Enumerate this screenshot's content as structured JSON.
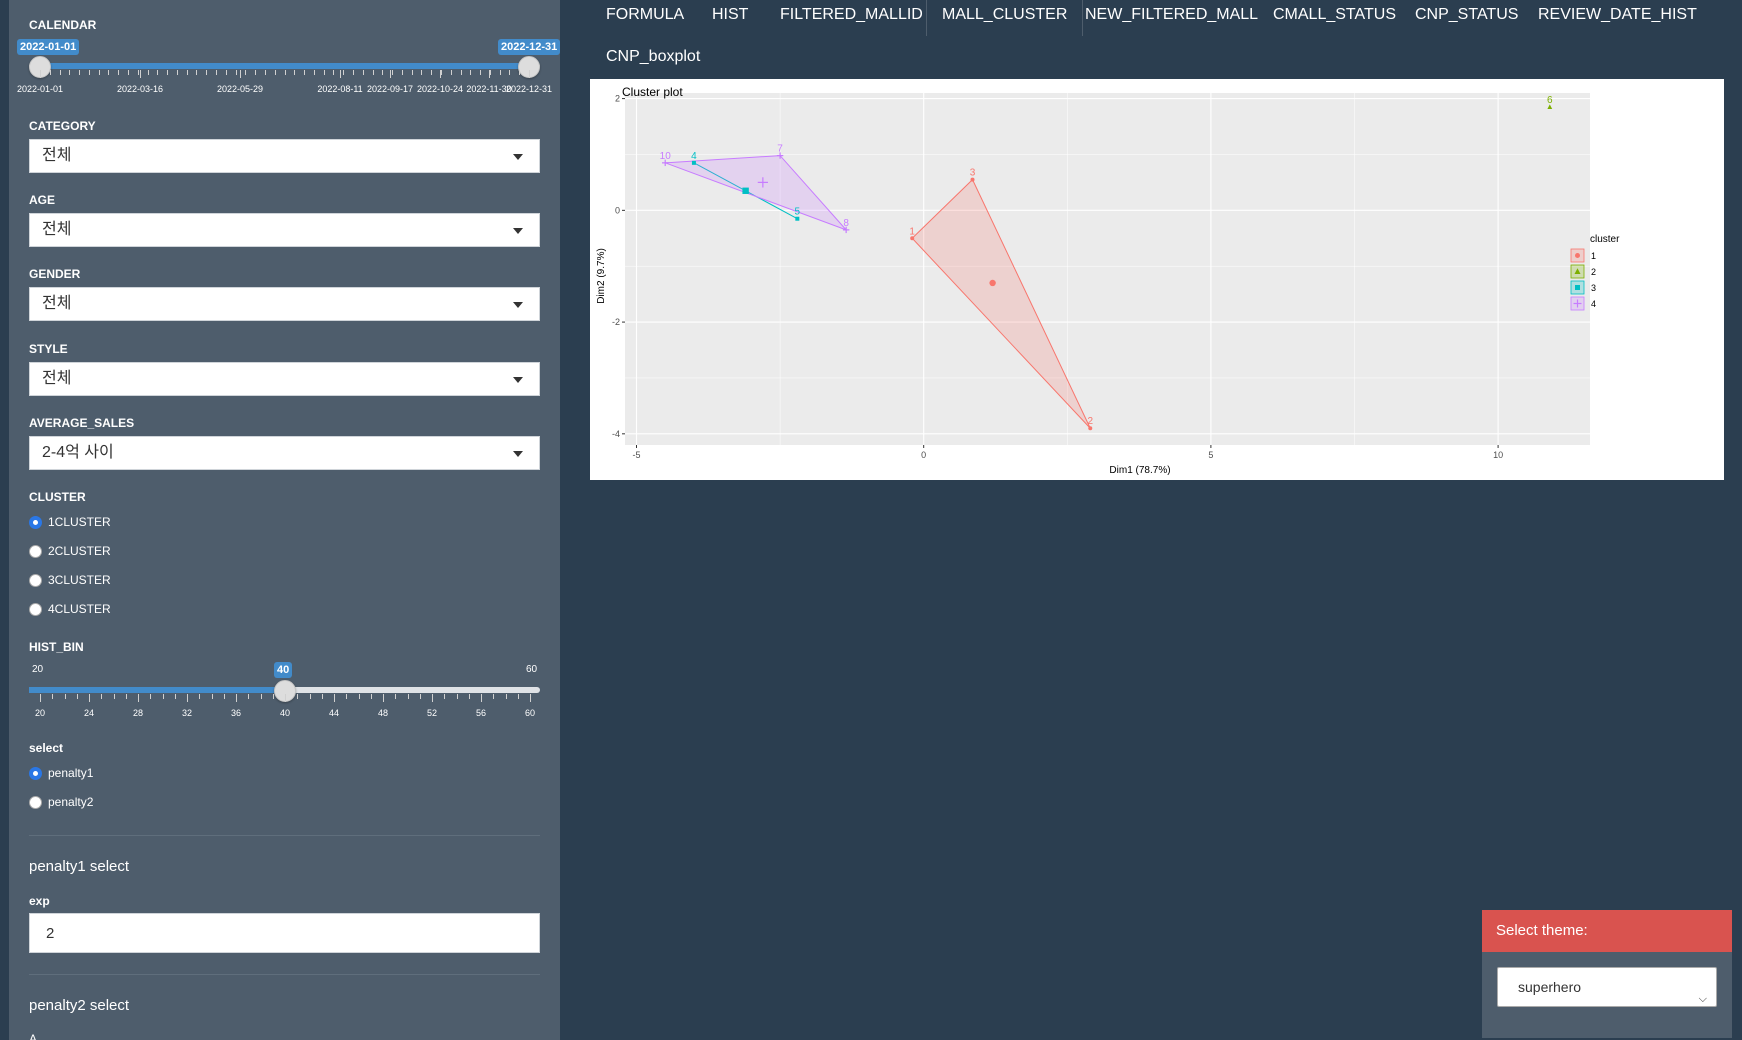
{
  "sidebar": {
    "calendar": {
      "label": "CALENDAR",
      "from": "2022-01-01",
      "to": "2022-12-31",
      "ticks": [
        "2022-01-01",
        "2022-03-16",
        "2022-05-29",
        "2022-08-11",
        "2022-09-17",
        "2022-10-24",
        "2022-11-30",
        "2022-12-31"
      ]
    },
    "category": {
      "label": "CATEGORY",
      "value": "전체"
    },
    "age": {
      "label": "AGE",
      "value": "전체"
    },
    "gender": {
      "label": "GENDER",
      "value": "전체"
    },
    "style": {
      "label": "STYLE",
      "value": "전체"
    },
    "average_sales": {
      "label": "AVERAGE_SALES",
      "value": "2-4억 사이"
    },
    "cluster": {
      "label": "CLUSTER",
      "options": [
        "1CLUSTER",
        "2CLUSTER",
        "3CLUSTER",
        "4CLUSTER"
      ],
      "selected": "1CLUSTER"
    },
    "hist_bin": {
      "label": "HIST_BIN",
      "min": "20",
      "max": "60",
      "value": "40",
      "ticks": [
        "20",
        "24",
        "28",
        "32",
        "36",
        "40",
        "44",
        "48",
        "52",
        "56",
        "60"
      ]
    },
    "select": {
      "label": "select",
      "options": [
        "penalty1",
        "penalty2"
      ],
      "selected": "penalty1"
    },
    "penalty1": {
      "title": "penalty1 select",
      "exp_label": "exp",
      "exp_value": "2"
    },
    "penalty2": {
      "title": "penalty2 select",
      "partial": "A"
    }
  },
  "tabs": [
    "FORMULA",
    "HIST",
    "FILTERED_MALLID",
    "MALL_CLUSTER",
    "NEW_FILTERED_MALL",
    "CMALL_STATUS",
    "CNP_STATUS",
    "REVIEW_DATE_HIST",
    "CNP_boxplot"
  ],
  "active_tab": "MALL_CLUSTER",
  "chart_data": {
    "type": "scatter",
    "title": "Cluster plot",
    "xlabel": "Dim1 (78.7%)",
    "ylabel": "Dim2 (9.7%)",
    "xlim": [
      -5.2,
      11.6
    ],
    "ylim": [
      -4.2,
      2.1
    ],
    "xticks": [
      "-5",
      "0",
      "5",
      "10"
    ],
    "yticks": [
      "2",
      "0",
      "-2",
      "-4"
    ],
    "legend": {
      "title": "cluster",
      "entries": [
        "1",
        "2",
        "3",
        "4"
      ],
      "position": "right"
    },
    "colors": {
      "1": "#f8766d",
      "2": "#7cae00",
      "3": "#00bfc4",
      "4": "#c77cff"
    },
    "points": [
      {
        "label": "1",
        "cluster": "1",
        "x": -0.2,
        "y": -0.5
      },
      {
        "label": "2",
        "cluster": "1",
        "x": 2.9,
        "y": -3.9
      },
      {
        "label": "3",
        "cluster": "1",
        "x": 0.85,
        "y": 0.55
      },
      {
        "label": "6",
        "cluster": "2",
        "x": 10.9,
        "y": 1.85
      },
      {
        "label": "4",
        "cluster": "3",
        "x": -4.0,
        "y": 0.85
      },
      {
        "label": "5",
        "cluster": "3",
        "x": -2.2,
        "y": -0.15
      },
      {
        "label": "10",
        "cluster": "4",
        "x": -4.5,
        "y": 0.85
      },
      {
        "label": "7",
        "cluster": "4",
        "x": -2.5,
        "y": 0.98
      },
      {
        "label": "8",
        "cluster": "4",
        "x": -1.35,
        "y": -0.35
      }
    ],
    "hulls": [
      {
        "cluster": "1",
        "points": [
          "1",
          "3",
          "2"
        ]
      },
      {
        "cluster": "3",
        "points": [
          "4",
          "5"
        ]
      },
      {
        "cluster": "4",
        "points": [
          "10",
          "7",
          "8"
        ]
      }
    ],
    "centers": [
      {
        "cluster": "1",
        "x": 1.2,
        "y": -1.3
      },
      {
        "cluster": "3",
        "x": -3.1,
        "y": 0.35
      },
      {
        "cluster": "4",
        "x": -2.8,
        "y": 0.5
      }
    ]
  },
  "theme": {
    "header": "Select theme:",
    "value": "superhero"
  }
}
